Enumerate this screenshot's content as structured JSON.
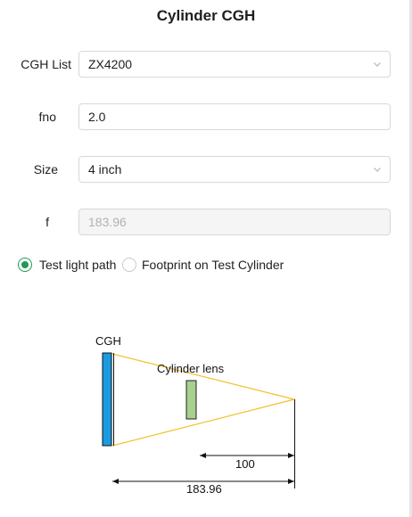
{
  "title": "Cylinder CGH",
  "form": {
    "cgh_list": {
      "label": "CGH List",
      "value": "ZX4200"
    },
    "fno": {
      "label": "fno",
      "value": "2.0"
    },
    "size": {
      "label": "Size",
      "value": "4 inch"
    },
    "f": {
      "label": "f",
      "value": "183.96"
    }
  },
  "mode": {
    "options": [
      "Test light path",
      "Footprint on Test Cylinder"
    ],
    "selected": "Test light path"
  },
  "diagram": {
    "cgh_label": "CGH",
    "lens_label": "Cylinder lens",
    "dim_short": "100",
    "dim_long": "183.96",
    "colors": {
      "cgh": "#1a9be0",
      "lens": "#a9d08e",
      "rays": "#f2c22b",
      "accent": "#1e9a57"
    }
  }
}
